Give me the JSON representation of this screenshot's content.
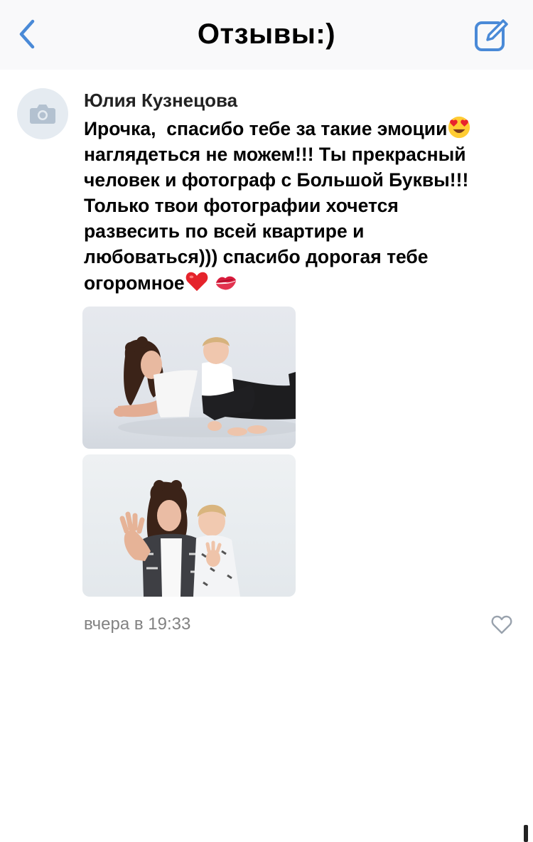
{
  "header": {
    "title": "Отзывы:)",
    "back_icon": "chevron-left-icon",
    "compose_icon": "compose-icon",
    "accent_color": "#4a8ad7"
  },
  "comment": {
    "author": "Юлия Кузнецова",
    "avatar_icon": "camera-icon",
    "text_lines": [
      "Ирочка,  спасибо тебе за такие эмоции",
      "наглядеться не можем!!! Ты прекрасный",
      "человек и фотограф с Большой Буквы!!!",
      "Только твои фотографии хочется",
      "развесить по всей квартире и",
      "любоваться))) спасибо дорогая тебе",
      "огоромное"
    ],
    "emojis": [
      "heart-eyes-emoji",
      "red-heart-emoji",
      "kiss-mark-emoji"
    ],
    "photos": [
      "photo-mother-and-son-lying",
      "photo-mother-and-son-waving"
    ],
    "timestamp": "вчера в 19:33",
    "like_icon": "heart-outline-icon"
  }
}
